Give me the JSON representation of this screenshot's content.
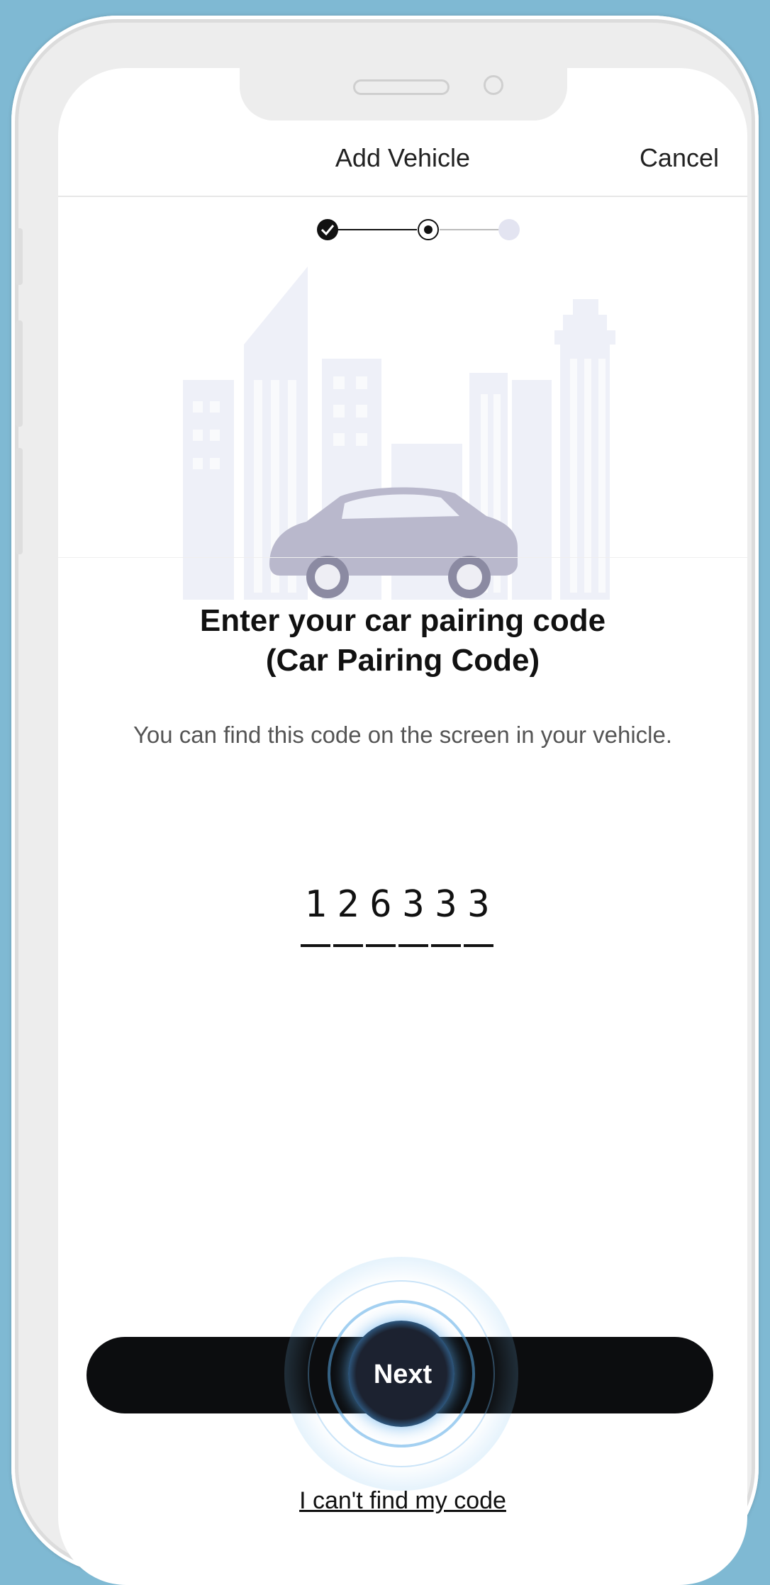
{
  "nav": {
    "title": "Add Vehicle",
    "cancel_label": "Cancel"
  },
  "stepper": {
    "steps": [
      "complete",
      "current",
      "upcoming"
    ]
  },
  "pairing": {
    "heading_line1": "Enter your car pairing code",
    "heading_line2": "(Car Pairing Code)",
    "subtext": "You can find this code on the screen in your vehicle.",
    "code_digits": [
      "1",
      "2",
      "6",
      "3",
      "3",
      "3"
    ]
  },
  "actions": {
    "next_label": "Next",
    "help_link": "I can't find my code"
  },
  "colors": {
    "background": "#7fb9d3",
    "button": "#0c0d0f",
    "accent_glow": "#4aa3e8",
    "illustration": "#eef0f8"
  }
}
